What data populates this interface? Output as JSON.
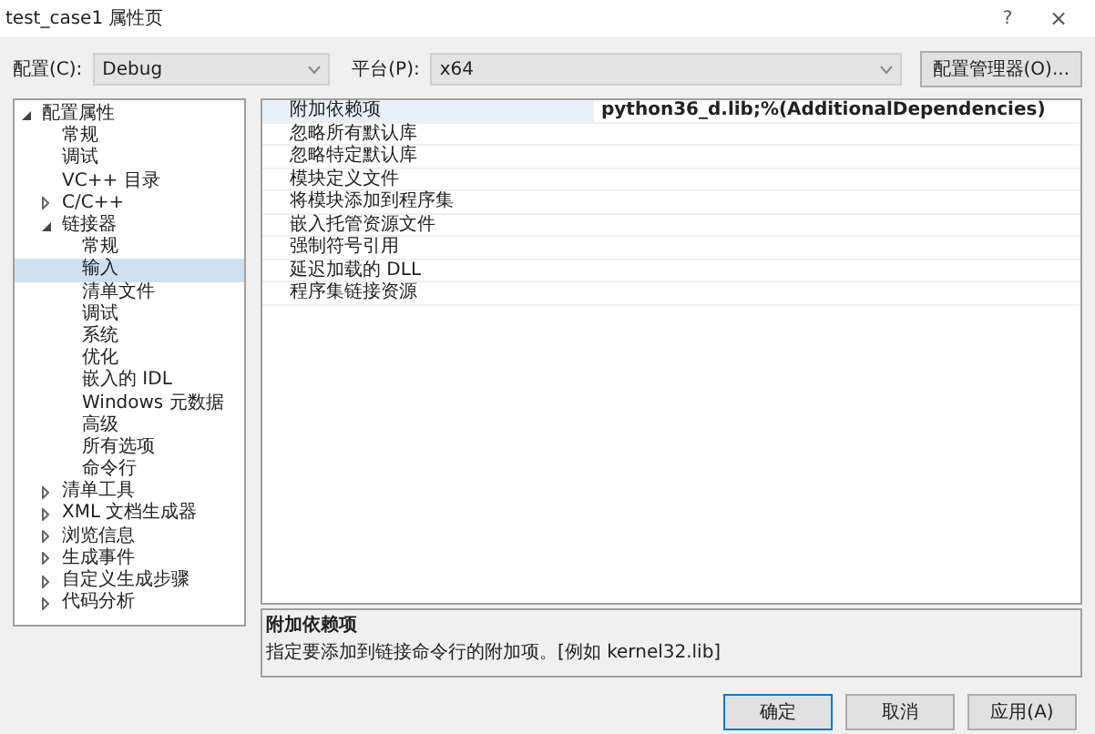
{
  "window": {
    "title": "test_case1 属性页",
    "help": "?",
    "close": "×"
  },
  "config": {
    "label": "配置(C):",
    "value": "Debug"
  },
  "platform": {
    "label": "平台(P):",
    "value": "x64"
  },
  "manager_button": "配置管理器(O)...",
  "tree": [
    {
      "label": "配置属性",
      "expanded": true,
      "selected": false,
      "children": [
        {
          "label": "常规",
          "selected": false
        },
        {
          "label": "调试",
          "selected": false
        },
        {
          "label": "VC++ 目录",
          "selected": false
        },
        {
          "label": "C/C++",
          "expanded": false,
          "selected": false
        },
        {
          "label": "链接器",
          "expanded": true,
          "selected": false,
          "children": [
            {
              "label": "常规",
              "selected": false
            },
            {
              "label": "输入",
              "selected": true
            },
            {
              "label": "清单文件",
              "selected": false
            },
            {
              "label": "调试",
              "selected": false
            },
            {
              "label": "系统",
              "selected": false
            },
            {
              "label": "优化",
              "selected": false
            },
            {
              "label": "嵌入的 IDL",
              "selected": false
            },
            {
              "label": "Windows 元数据",
              "selected": false
            },
            {
              "label": "高级",
              "selected": false
            },
            {
              "label": "所有选项",
              "selected": false
            },
            {
              "label": "命令行",
              "selected": false
            }
          ]
        },
        {
          "label": "清单工具",
          "expanded": false,
          "selected": false
        },
        {
          "label": "XML 文档生成器",
          "expanded": false,
          "selected": false
        },
        {
          "label": "浏览信息",
          "expanded": false,
          "selected": false
        },
        {
          "label": "生成事件",
          "expanded": false,
          "selected": false
        },
        {
          "label": "自定义生成步骤",
          "expanded": false,
          "selected": false
        },
        {
          "label": "代码分析",
          "expanded": false,
          "selected": false
        }
      ]
    }
  ],
  "properties": [
    {
      "name": "附加依赖项",
      "value": "python36_d.lib;%(AdditionalDependencies)",
      "selected": true
    },
    {
      "name": "忽略所有默认库",
      "selected": false
    },
    {
      "name": "忽略特定默认库",
      "selected": false
    },
    {
      "name": "模块定义文件",
      "selected": false
    },
    {
      "name": "将模块添加到程序集",
      "selected": false
    },
    {
      "name": "嵌入托管资源文件",
      "selected": false
    },
    {
      "name": "强制符号引用",
      "selected": false
    },
    {
      "name": "延迟加载的 DLL",
      "selected": false
    },
    {
      "name": "程序集链接资源",
      "selected": false
    }
  ],
  "description": {
    "title": "附加依赖项",
    "text": "指定要添加到链接命令行的附加项。[例如 kernel32.lib]"
  },
  "buttons": [
    "确定",
    "取消",
    "应用(A)"
  ]
}
